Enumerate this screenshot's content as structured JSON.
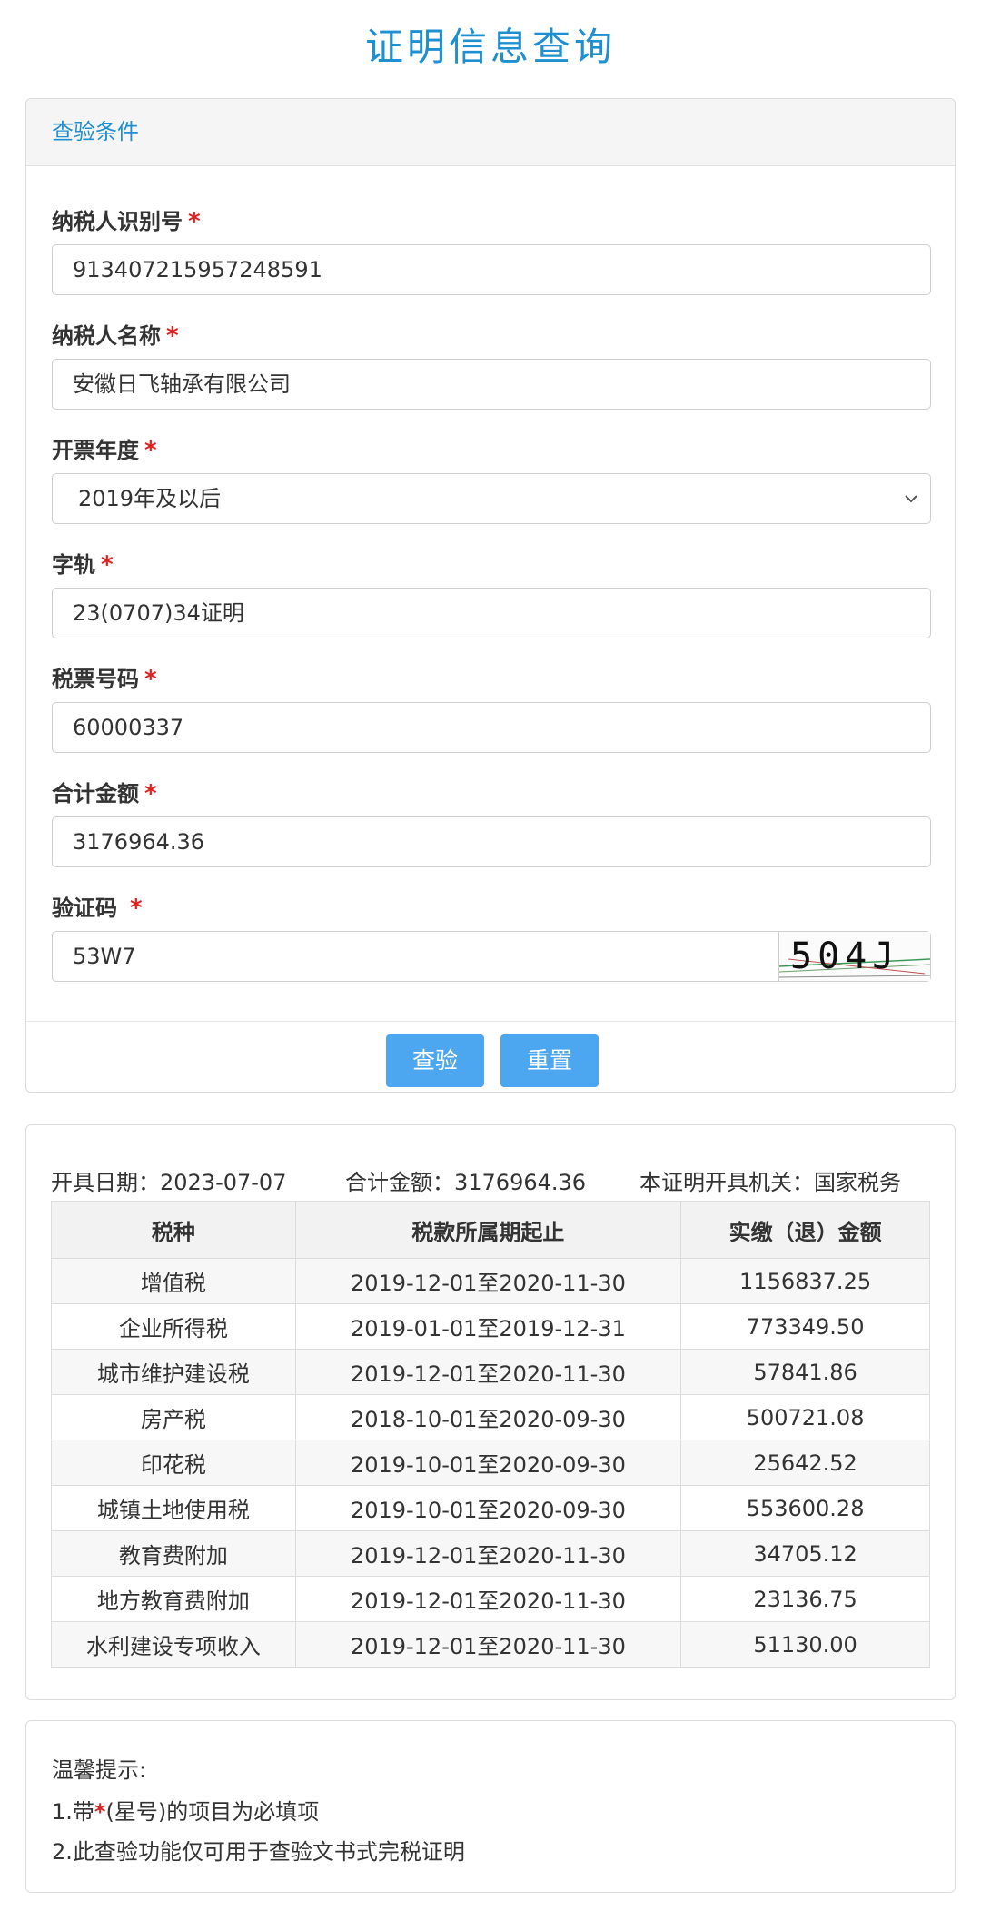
{
  "page": {
    "title": "证明信息查询"
  },
  "query_panel": {
    "header": "查验条件",
    "required_mark": "*",
    "fields": [
      {
        "label": "纳税人识别号",
        "value": "913407215957248591"
      },
      {
        "label": "纳税人名称",
        "value": "安徽日飞轴承有限公司"
      },
      {
        "label": "开票年度",
        "value": "2019年及以后"
      },
      {
        "label": "字轨",
        "value": "23(0707)34证明"
      },
      {
        "label": "税票号码",
        "value": "60000337"
      },
      {
        "label": "合计金额",
        "value": "3176964.36"
      },
      {
        "label": "验证码",
        "value": "53W7"
      }
    ],
    "captcha_text": "504J",
    "buttons": {
      "check": "查验",
      "reset": "重置"
    }
  },
  "result_panel": {
    "issue_date": "开具日期：2023-07-07",
    "total": "合计金额：3176964.36",
    "authority": "本证明开具机关：国家税务",
    "columns": [
      "税种",
      "税款所属期起止",
      "实缴（退）金额"
    ],
    "rows": [
      [
        "增值税",
        "2019-12-01至2020-11-30",
        "1156837.25"
      ],
      [
        "企业所得税",
        "2019-01-01至2019-12-31",
        "773349.50"
      ],
      [
        "城市维护建设税",
        "2019-12-01至2020-11-30",
        "57841.86"
      ],
      [
        "房产税",
        "2018-10-01至2020-09-30",
        "500721.08"
      ],
      [
        "印花税",
        "2019-10-01至2020-09-30",
        "25642.52"
      ],
      [
        "城镇土地使用税",
        "2019-10-01至2020-09-30",
        "553600.28"
      ],
      [
        "教育费附加",
        "2019-12-01至2020-11-30",
        "34705.12"
      ],
      [
        "地方教育费附加",
        "2019-12-01至2020-11-30",
        "23136.75"
      ],
      [
        "水利建设专项收入",
        "2019-12-01至2020-11-30",
        "51130.00"
      ]
    ]
  },
  "tips": {
    "title": "温馨提示:",
    "line1_prefix": "1.带",
    "line1_star": "*",
    "line1_suffix": "(星号)的项目为必填项",
    "line2": "2.此查验功能仅可用于查验文书式完税证明"
  }
}
